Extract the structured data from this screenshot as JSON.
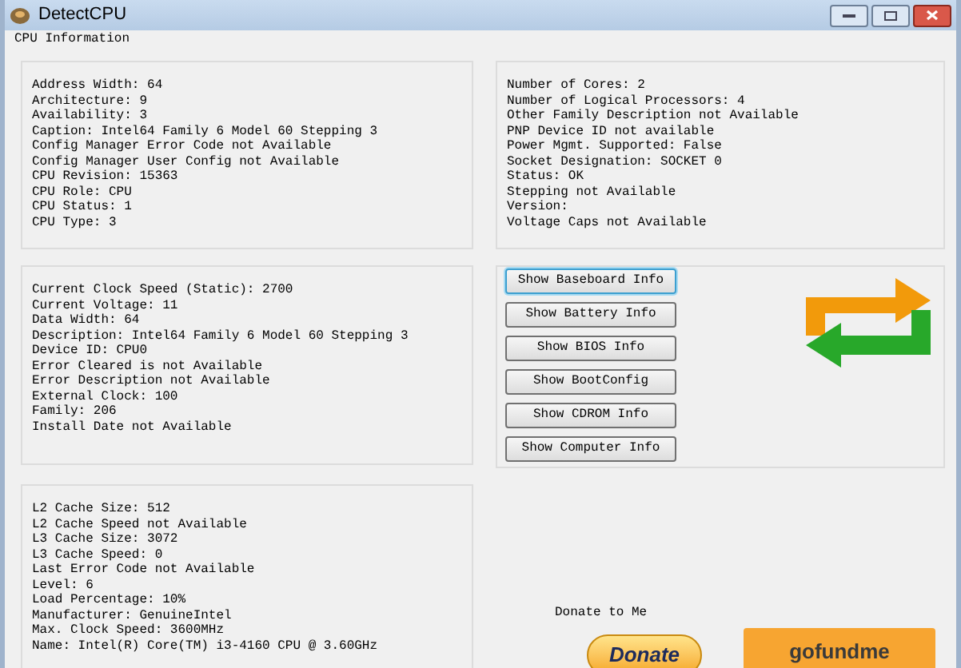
{
  "window": {
    "title": "DetectCPU"
  },
  "group_title": "CPU Information",
  "panels": [
    {
      "lines": [
        "Address Width: 64",
        "Architecture: 9",
        "Availability: 3",
        "Caption: Intel64 Family 6 Model 60 Stepping 3",
        "Config Manager Error Code not Available",
        "Config Manager User Config not Available",
        "CPU Revision: 15363",
        "CPU Role: CPU",
        "CPU Status: 1",
        "CPU Type: 3"
      ]
    },
    {
      "lines": [
        "Number of Cores: 2",
        "Number of Logical Processors: 4",
        "Other Family Description not Available",
        "PNP Device ID not available",
        "Power Mgmt. Supported: False",
        "Socket Designation: SOCKET 0",
        "Status: OK",
        "Stepping not Available",
        "Version:",
        "Voltage Caps not Available"
      ]
    },
    {
      "lines": [
        "Current Clock Speed (Static): 2700",
        "Current Voltage: 11",
        "Data Width: 64",
        "Description: Intel64 Family 6 Model 60 Stepping 3",
        "Device ID: CPU0",
        "Error Cleared is not Available",
        "Error Description not Available",
        "External Clock: 100",
        "Family: 206",
        "Install Date not Available"
      ]
    },
    {
      "lines": [
        "L2 Cache Size: 512",
        "L2 Cache Speed not Available",
        "L3 Cache Size: 3072",
        "L3 Cache Speed: 0",
        "Last Error Code not Available",
        "Level: 6",
        "Load Percentage: 10%",
        "Manufacturer: GenuineIntel",
        "Max. Clock Speed: 3600MHz",
        "Name: Intel(R) Core(TM) i3-4160 CPU @ 3.60GHz"
      ]
    }
  ],
  "buttons": [
    {
      "label": "Show Baseboard Info",
      "selected": true
    },
    {
      "label": "Show Battery Info",
      "selected": false
    },
    {
      "label": "Show BIOS Info",
      "selected": false
    },
    {
      "label": "Show BootConfig",
      "selected": false
    },
    {
      "label": "Show CDROM Info",
      "selected": false
    },
    {
      "label": "Show Computer Info",
      "selected": false
    }
  ],
  "donate": {
    "caption": "Donate to Me",
    "button": "Donate",
    "gofundme": "gofundme"
  }
}
